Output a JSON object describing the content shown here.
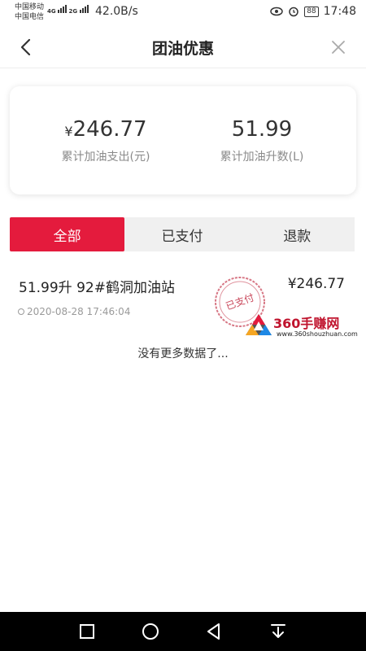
{
  "status_bar": {
    "carrier_1": "中国移动",
    "carrier_2": "中国电信",
    "net_1": "4G",
    "net_2": "2G",
    "speed": "42.0B/s",
    "battery": "88",
    "time": "17:48"
  },
  "header": {
    "title": "团油优惠",
    "back_icon": "chevron-left-icon",
    "close_icon": "close-icon"
  },
  "summary": {
    "spend_currency": "¥",
    "spend_value": "246.77",
    "spend_label": "累计加油支出(元)",
    "liters_value": "51.99",
    "liters_label": "累计加油升数(L)"
  },
  "tabs": [
    {
      "label": "全部",
      "active": true
    },
    {
      "label": "已支付",
      "active": false
    },
    {
      "label": "退款",
      "active": false
    }
  ],
  "records": [
    {
      "title": "51.99升  92#鹤洞加油站",
      "amount": "¥246.77",
      "time": "2020-08-28 17:46:04",
      "stamp": "已支付"
    }
  ],
  "no_more_text": "没有更多数据了...",
  "watermark": {
    "name": "360手赚网",
    "url": "www.360shouzhuan.com"
  },
  "colors": {
    "accent": "#e41b3d",
    "stamp": "#c9495c"
  },
  "nav_bar": {
    "icons": [
      "square-icon",
      "circle-home-icon",
      "triangle-back-icon",
      "notification-down-icon"
    ]
  }
}
